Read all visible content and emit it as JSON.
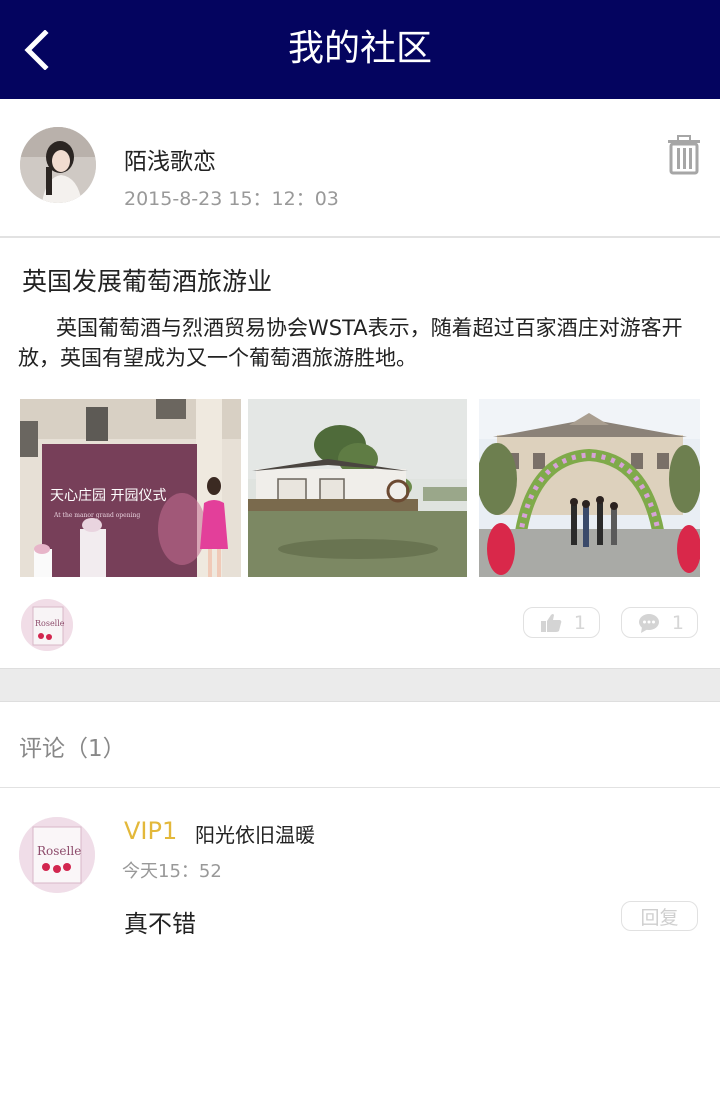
{
  "header": {
    "title": "我的社区",
    "back_icon": "chevron-left-icon"
  },
  "post": {
    "author_name": "陌浅歌恋",
    "timestamp": "2015-8-23  15：12：03",
    "delete_icon": "trash-icon",
    "title": "英国发展葡萄酒旅游业",
    "body": "英国葡萄酒与烈酒贸易协会WSTA表示，随着超过百家酒庄对游客开放，英国有望成为又一个葡萄酒旅游胜地。",
    "photos": [
      {
        "caption": "天心庄园 开园仪式",
        "subcaption": "At the manor grand opening"
      },
      {
        "caption": ""
      },
      {
        "caption": ""
      }
    ],
    "liker_avatar_text": "Roselle",
    "like_count": "1",
    "comment_count": "1"
  },
  "comments": {
    "heading": "评论（1）",
    "items": [
      {
        "vip": "VIP1",
        "name": "阳光依旧温暖",
        "time": "今天15：52",
        "text": "真不错",
        "reply_label": "回复",
        "avatar_text": "Roselle"
      }
    ]
  },
  "colors": {
    "header_bg": "#04045f",
    "vip": "#e3b83a",
    "muted": "#999999"
  }
}
